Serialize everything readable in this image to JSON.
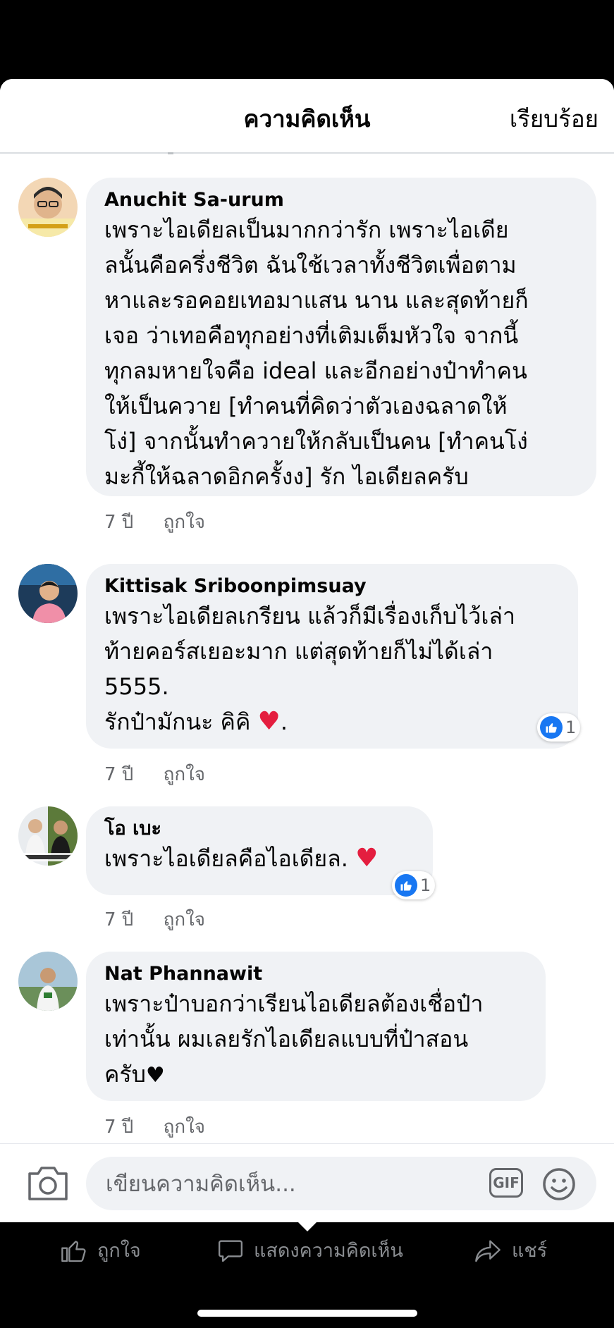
{
  "header": {
    "title": "ความคิดเห็น",
    "done_label": "เรียบร้อย"
  },
  "comments": [
    {
      "author": "Anuchit Sa-urum",
      "lines": [
        "เพราะไอเดียลเป็นมากกว่ารัก เพราะไอเดีย",
        "ลนั้นคือครึ่งชีวิต ฉันใช้เวลาทั้งชีวิตเพื่อตาม",
        "หาและรอคอยเทอมาแสน นาน และสุดท้ายก็",
        "เจอ ว่าเทอคือทุกอย่างที่เติมเต็มหัวใจ จากนี้",
        "ทุกลมหายใจคือ ideal และอีกอย่างป๋าทำคน",
        "ให้เป็นควาย [ทำคนที่คิดว่าตัวเองฉลาดให้",
        "โง่] จากนั้นทำควายให้กลับเป็นคน [ทำคนโง่",
        "มะกี้ให้ฉลาดอิกครั้งง] รัก ไอเดียลครับ"
      ],
      "time": "7 ปี",
      "like_label": "ถูกใจ"
    },
    {
      "author": "Kittisak Sriboonpimsuay",
      "lines": [
        "เพราะไอเดียลเกรียน แล้วก็มีเรื่องเก็บไว้เล่า",
        "ท้ายคอร์สเยอะมาก แต่สุดท้ายก็ไม่ได้เล่า",
        "5555.",
        "รักป๋ามักนะ คิคิ"
      ],
      "trailing": ".",
      "time": "7 ปี",
      "like_label": "ถูกใจ",
      "reaction_count": "1"
    },
    {
      "author": "โอ เบะ",
      "lines": [
        "เพราะไอเดียลคือไอเดียล."
      ],
      "time": "7 ปี",
      "like_label": "ถูกใจ",
      "reaction_count": "1"
    },
    {
      "author": "Nat Phannawit",
      "lines": [
        "เพราะป๋าบอกว่าเรียนไอเดียลต้องเชื่อป๋า",
        "เท่านั้น ผมเลยรักไอเดียลแบบที่ป๋าสอน",
        "ครับ"
      ],
      "time": "7 ปี",
      "like_label": "ถูกใจ"
    }
  ],
  "composer": {
    "placeholder": "เขียนความคิดเห็น...",
    "gif_label": "GIF"
  },
  "actions": {
    "like": "ถูกใจ",
    "comment": "แสดงความคิดเห็น",
    "share": "แชร์"
  },
  "colors": {
    "bubble": "#f0f2f5",
    "like_blue": "#1877f2",
    "heart_red": "#e41e3f",
    "muted": "#65676b"
  }
}
